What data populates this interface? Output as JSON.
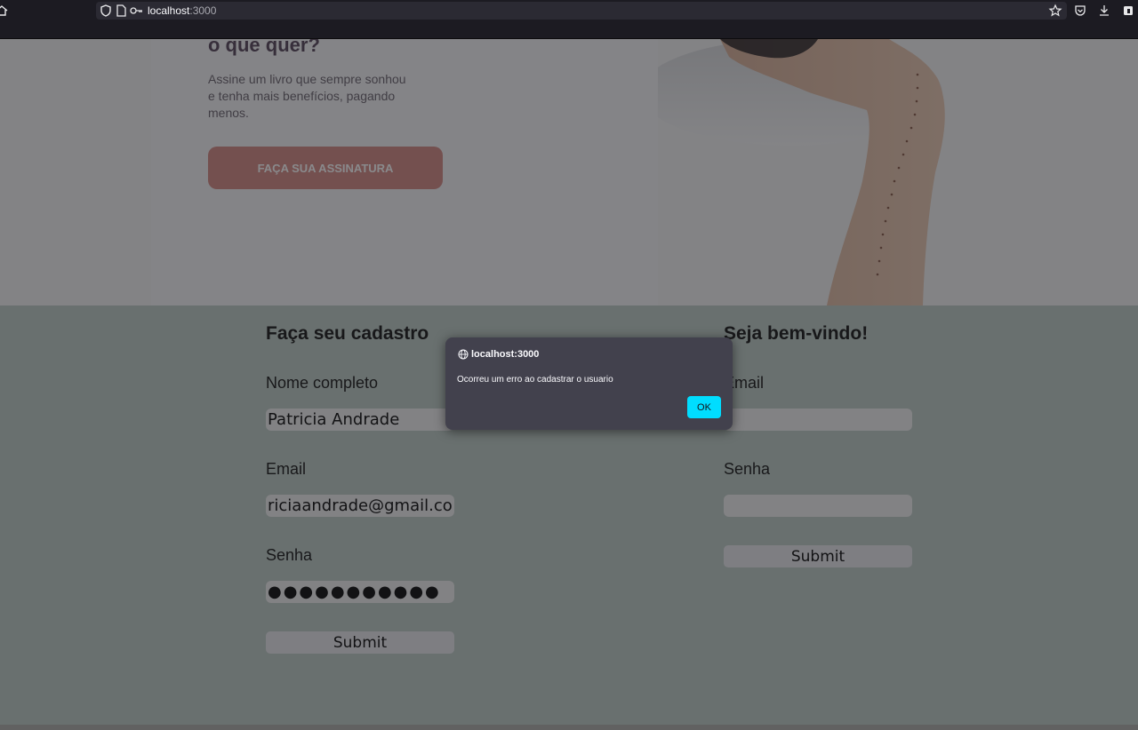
{
  "browser": {
    "url_host": "localhost",
    "url_port": ":3000",
    "icons": [
      "home-icon",
      "shield-icon",
      "page-icon",
      "key-icon",
      "star-icon",
      "pocket-icon",
      "download-icon",
      "extension-icon"
    ]
  },
  "hero": {
    "heading": "o que quer?",
    "text": "Assine um livro que sempre sonhou e tenha mais benefícios, pagando menos.",
    "cta_label": "FAÇA SUA ASSINATURA"
  },
  "signup": {
    "title": "Faça seu cadastro",
    "name_label": "Nome completo",
    "name_value": "Patricia Andrade",
    "email_label": "Email",
    "email_value": "riciaandrade@gmail.com",
    "password_label": "Senha",
    "password_value": "●●●●●●●●●●●",
    "submit_label": "Submit"
  },
  "login": {
    "title": "Seja bem-vindo!",
    "email_label": "Email",
    "email_value": "",
    "password_label": "Senha",
    "password_value": "",
    "submit_label": "Submit"
  },
  "dialog": {
    "origin": "localhost:3000",
    "message": "Ocorreu um erro ao cadastrar o usuario",
    "ok_label": "OK"
  },
  "colors": {
    "cta": "#d58c86",
    "forms_bg": "#bfcdc6",
    "dialog_bg": "#42414d",
    "ok_button": "#00ddff"
  }
}
